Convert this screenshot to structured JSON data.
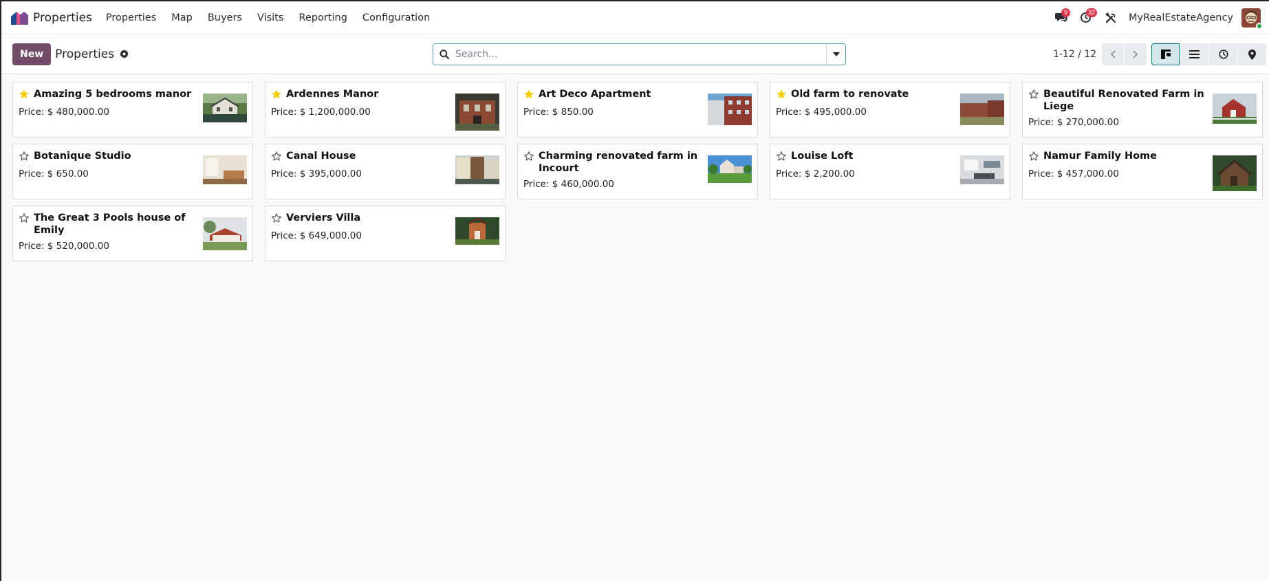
{
  "navbar": {
    "app_name": "Properties",
    "menu": [
      "Properties",
      "Map",
      "Buyers",
      "Visits",
      "Reporting",
      "Configuration"
    ],
    "messages_badge": "9",
    "activities_badge": "32",
    "company": "MyRealEstateAgency"
  },
  "control": {
    "new_label": "New",
    "title": "Properties",
    "search_placeholder": "Search...",
    "pager": "1-12 / 12"
  },
  "colors": {
    "brand": "#714b67",
    "accent": "#017e84",
    "star": "#f3cc00"
  },
  "cards": [
    {
      "title": "Amazing 5 bedrooms manor",
      "price": "Price: $ 480,000.00",
      "starred": true
    },
    {
      "title": "Ardennes Manor",
      "price": "Price: $ 1,200,000.00",
      "starred": true
    },
    {
      "title": "Art Deco Apartment",
      "price": "Price: $ 850.00",
      "starred": true
    },
    {
      "title": "Old farm to renovate",
      "price": "Price: $ 495,000.00",
      "starred": true
    },
    {
      "title": "Beautiful Renovated Farm in Liege",
      "price": "Price: $ 270,000.00",
      "starred": false
    },
    {
      "title": "Botanique Studio",
      "price": "Price: $ 650.00",
      "starred": false
    },
    {
      "title": "Canal House",
      "price": "Price: $ 395,000.00",
      "starred": false
    },
    {
      "title": "Charming renovated farm in Incourt",
      "price": "Price: $ 460,000.00",
      "starred": false
    },
    {
      "title": "Louise Loft",
      "price": "Price: $ 2,200.00",
      "starred": false
    },
    {
      "title": "Namur Family Home",
      "price": "Price: $ 457,000.00",
      "starred": false
    },
    {
      "title": "The Great 3 Pools house of Emily",
      "price": "Price: $ 520,000.00",
      "starred": false
    },
    {
      "title": "Verviers Villa",
      "price": "Price: $ 649,000.00",
      "starred": false
    }
  ]
}
